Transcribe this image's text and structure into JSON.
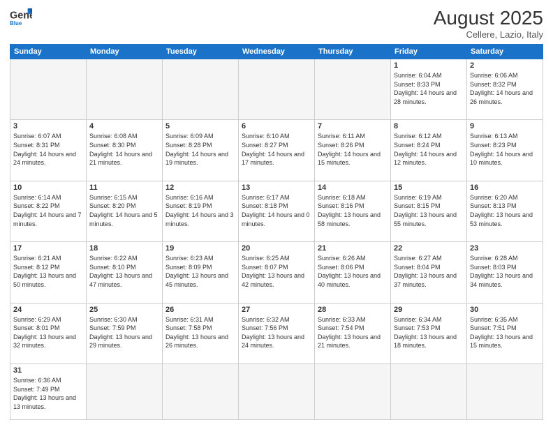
{
  "header": {
    "logo_general": "General",
    "logo_blue": "Blue",
    "month_year": "August 2025",
    "subtitle": "Cellere, Lazio, Italy"
  },
  "days_of_week": [
    "Sunday",
    "Monday",
    "Tuesday",
    "Wednesday",
    "Thursday",
    "Friday",
    "Saturday"
  ],
  "weeks": [
    [
      {
        "day": "",
        "info": "",
        "empty": true
      },
      {
        "day": "",
        "info": "",
        "empty": true
      },
      {
        "day": "",
        "info": "",
        "empty": true
      },
      {
        "day": "",
        "info": "",
        "empty": true
      },
      {
        "day": "",
        "info": "",
        "empty": true
      },
      {
        "day": "1",
        "info": "Sunrise: 6:04 AM\nSunset: 8:33 PM\nDaylight: 14 hours and 28 minutes."
      },
      {
        "day": "2",
        "info": "Sunrise: 6:06 AM\nSunset: 8:32 PM\nDaylight: 14 hours and 26 minutes."
      }
    ],
    [
      {
        "day": "3",
        "info": "Sunrise: 6:07 AM\nSunset: 8:31 PM\nDaylight: 14 hours and 24 minutes."
      },
      {
        "day": "4",
        "info": "Sunrise: 6:08 AM\nSunset: 8:30 PM\nDaylight: 14 hours and 21 minutes."
      },
      {
        "day": "5",
        "info": "Sunrise: 6:09 AM\nSunset: 8:28 PM\nDaylight: 14 hours and 19 minutes."
      },
      {
        "day": "6",
        "info": "Sunrise: 6:10 AM\nSunset: 8:27 PM\nDaylight: 14 hours and 17 minutes."
      },
      {
        "day": "7",
        "info": "Sunrise: 6:11 AM\nSunset: 8:26 PM\nDaylight: 14 hours and 15 minutes."
      },
      {
        "day": "8",
        "info": "Sunrise: 6:12 AM\nSunset: 8:24 PM\nDaylight: 14 hours and 12 minutes."
      },
      {
        "day": "9",
        "info": "Sunrise: 6:13 AM\nSunset: 8:23 PM\nDaylight: 14 hours and 10 minutes."
      }
    ],
    [
      {
        "day": "10",
        "info": "Sunrise: 6:14 AM\nSunset: 8:22 PM\nDaylight: 14 hours and 7 minutes."
      },
      {
        "day": "11",
        "info": "Sunrise: 6:15 AM\nSunset: 8:20 PM\nDaylight: 14 hours and 5 minutes."
      },
      {
        "day": "12",
        "info": "Sunrise: 6:16 AM\nSunset: 8:19 PM\nDaylight: 14 hours and 3 minutes."
      },
      {
        "day": "13",
        "info": "Sunrise: 6:17 AM\nSunset: 8:18 PM\nDaylight: 14 hours and 0 minutes."
      },
      {
        "day": "14",
        "info": "Sunrise: 6:18 AM\nSunset: 8:16 PM\nDaylight: 13 hours and 58 minutes."
      },
      {
        "day": "15",
        "info": "Sunrise: 6:19 AM\nSunset: 8:15 PM\nDaylight: 13 hours and 55 minutes."
      },
      {
        "day": "16",
        "info": "Sunrise: 6:20 AM\nSunset: 8:13 PM\nDaylight: 13 hours and 53 minutes."
      }
    ],
    [
      {
        "day": "17",
        "info": "Sunrise: 6:21 AM\nSunset: 8:12 PM\nDaylight: 13 hours and 50 minutes."
      },
      {
        "day": "18",
        "info": "Sunrise: 6:22 AM\nSunset: 8:10 PM\nDaylight: 13 hours and 47 minutes."
      },
      {
        "day": "19",
        "info": "Sunrise: 6:23 AM\nSunset: 8:09 PM\nDaylight: 13 hours and 45 minutes."
      },
      {
        "day": "20",
        "info": "Sunrise: 6:25 AM\nSunset: 8:07 PM\nDaylight: 13 hours and 42 minutes."
      },
      {
        "day": "21",
        "info": "Sunrise: 6:26 AM\nSunset: 8:06 PM\nDaylight: 13 hours and 40 minutes."
      },
      {
        "day": "22",
        "info": "Sunrise: 6:27 AM\nSunset: 8:04 PM\nDaylight: 13 hours and 37 minutes."
      },
      {
        "day": "23",
        "info": "Sunrise: 6:28 AM\nSunset: 8:03 PM\nDaylight: 13 hours and 34 minutes."
      }
    ],
    [
      {
        "day": "24",
        "info": "Sunrise: 6:29 AM\nSunset: 8:01 PM\nDaylight: 13 hours and 32 minutes."
      },
      {
        "day": "25",
        "info": "Sunrise: 6:30 AM\nSunset: 7:59 PM\nDaylight: 13 hours and 29 minutes."
      },
      {
        "day": "26",
        "info": "Sunrise: 6:31 AM\nSunset: 7:58 PM\nDaylight: 13 hours and 26 minutes."
      },
      {
        "day": "27",
        "info": "Sunrise: 6:32 AM\nSunset: 7:56 PM\nDaylight: 13 hours and 24 minutes."
      },
      {
        "day": "28",
        "info": "Sunrise: 6:33 AM\nSunset: 7:54 PM\nDaylight: 13 hours and 21 minutes."
      },
      {
        "day": "29",
        "info": "Sunrise: 6:34 AM\nSunset: 7:53 PM\nDaylight: 13 hours and 18 minutes."
      },
      {
        "day": "30",
        "info": "Sunrise: 6:35 AM\nSunset: 7:51 PM\nDaylight: 13 hours and 15 minutes."
      }
    ],
    [
      {
        "day": "31",
        "info": "Sunrise: 6:36 AM\nSunset: 7:49 PM\nDaylight: 13 hours and 13 minutes."
      },
      {
        "day": "",
        "info": "",
        "empty": true
      },
      {
        "day": "",
        "info": "",
        "empty": true
      },
      {
        "day": "",
        "info": "",
        "empty": true
      },
      {
        "day": "",
        "info": "",
        "empty": true
      },
      {
        "day": "",
        "info": "",
        "empty": true
      },
      {
        "day": "",
        "info": "",
        "empty": true
      }
    ]
  ]
}
